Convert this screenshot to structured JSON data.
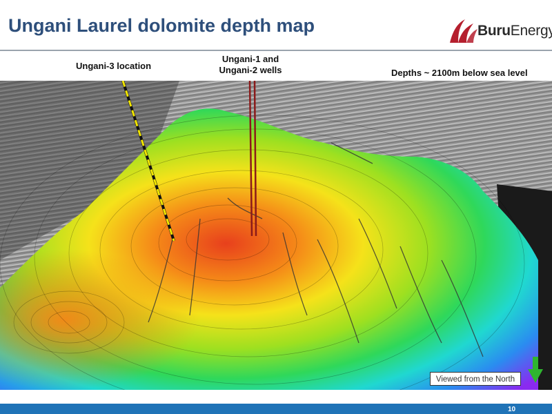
{
  "slide": {
    "title": "Ungani Laurel dolomite depth map",
    "page_number": "10"
  },
  "logo": {
    "brand_bold": "Buru",
    "brand_light": "Energy",
    "colors": {
      "red": "#b51f2e",
      "text": "#2a2a2a"
    }
  },
  "labels": {
    "ungani3": "Ungani-3 location",
    "ungani12_line1": "Ungani-1 and",
    "ungani12_line2": "Ungani-2 wells",
    "depths": "Depths ~ 2100m below sea level"
  },
  "view_note": "Viewed from the North",
  "colors": {
    "title": "#2e4f7b",
    "footer_bar": "#1f73b7",
    "well_trajectory": "#8b1a1a",
    "ungani3_trajectory": "#f2e600",
    "north_arrow": "#2fb52f"
  }
}
